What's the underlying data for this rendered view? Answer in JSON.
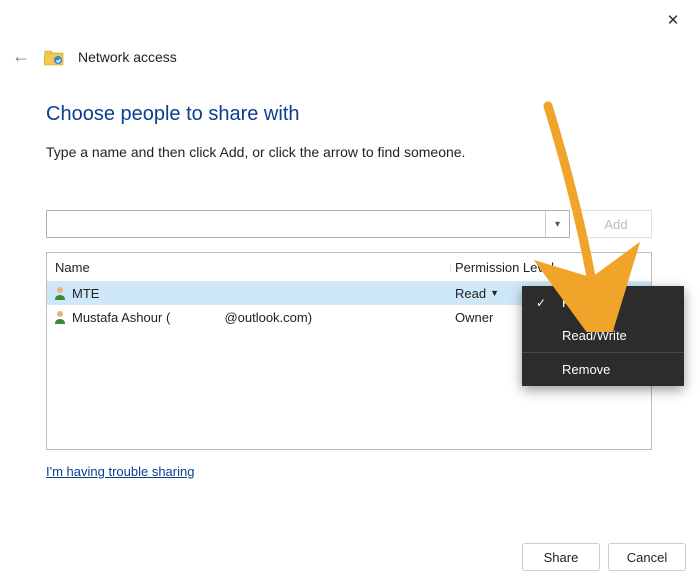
{
  "window": {
    "title": "Network access"
  },
  "heading": "Choose people to share with",
  "subtext": "Type a name and then click Add, or click the arrow to find someone.",
  "addButton": "Add",
  "table": {
    "headers": {
      "name": "Name",
      "permission": "Permission Level"
    },
    "rows": [
      {
        "name": "MTE",
        "permission": "Read",
        "selected": true,
        "hasCaret": true
      },
      {
        "name": "Mustafa Ashour (               @outlook.com)",
        "permission": "Owner",
        "selected": false,
        "hasCaret": false
      }
    ]
  },
  "troubleLink": "I'm having trouble sharing",
  "footer": {
    "share": "Share",
    "cancel": "Cancel"
  },
  "contextMenu": {
    "items": {
      "read": "Read",
      "readwrite": "Read/Write",
      "remove": "Remove"
    }
  }
}
